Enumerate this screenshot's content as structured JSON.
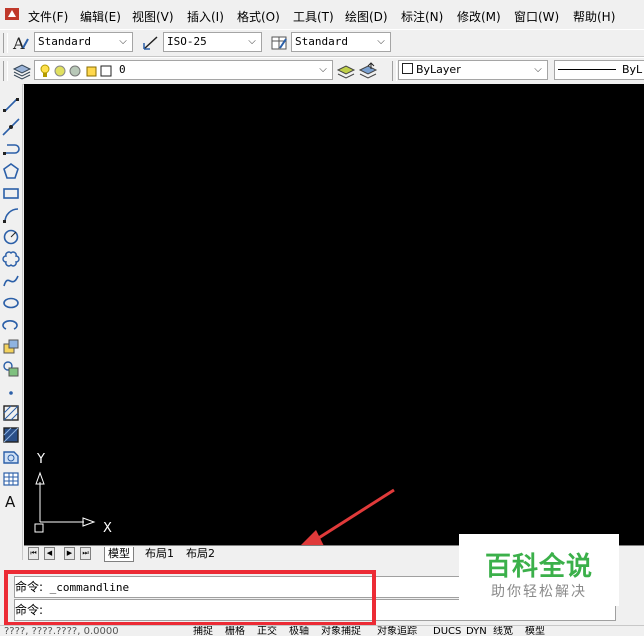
{
  "menubar": {
    "items": [
      "文件(F)",
      "编辑(E)",
      "视图(V)",
      "插入(I)",
      "格式(O)",
      "工具(T)",
      "绘图(D)",
      "标注(N)",
      "修改(M)",
      "窗口(W)",
      "帮助(H)"
    ]
  },
  "toolbar_styles": {
    "text_style": "Standard",
    "dim_style": "ISO-25",
    "table_style": "Standard"
  },
  "toolbar_layers": {
    "current_layer": "0",
    "color": "ByLayer",
    "linetype": "ByL"
  },
  "draw_tools": [
    "line-icon",
    "construction-line-icon",
    "polyline-icon",
    "polygon-icon",
    "rectangle-icon",
    "arc-icon",
    "circle-icon",
    "revision-cloud-icon",
    "spline-icon",
    "ellipse-icon",
    "ellipse-arc-icon",
    "insert-block-icon",
    "make-block-icon",
    "point-icon",
    "hatch-icon",
    "gradient-icon",
    "region-icon",
    "table-icon",
    "multiline-text-icon"
  ],
  "canvas": {
    "ucs_y_label": "Y",
    "ucs_x_label": "X"
  },
  "layout_tabs": [
    "模型",
    "布局1",
    "布局2"
  ],
  "command": {
    "line1_prompt": "命令:",
    "line1_text": "_commandline",
    "line2_prompt": "命令:"
  },
  "statusbar": {
    "coordinates": "????, ????.????, 0.0000",
    "buttons": [
      "捕捉",
      "栅格",
      "正交",
      "极轴",
      "对象捕捉",
      "对象追踪",
      "DUCS",
      "DYN",
      "线宽",
      "模型"
    ]
  },
  "watermark": {
    "title": "百科全说",
    "subtitle": "助你轻松解决"
  },
  "colors": {
    "canvas": "#000000",
    "highlight": "#ec2b35",
    "watermark_green": "#3bb04a"
  }
}
